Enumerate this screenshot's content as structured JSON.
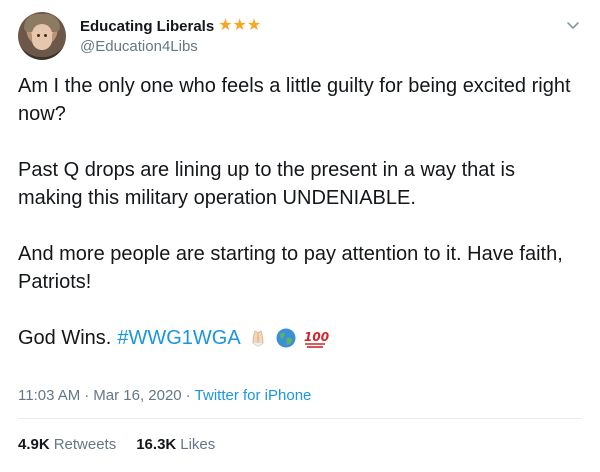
{
  "header": {
    "display_name": "Educating Liberals",
    "handle": "@Education4Libs",
    "badge_icons": [
      "star-icon",
      "star-icon",
      "star-icon"
    ],
    "more_icon": "chevron-down-icon"
  },
  "body": {
    "para1": "Am I the only one who feels a little guilty for being excited right now?",
    "para2": "Past Q drops are lining up to the present in a way that is making this military operation UNDENIABLE.",
    "para3": "And more people are starting to pay attention to it. Have faith, Patriots!",
    "para4_text": "God Wins.",
    "para4_hashtag": "#WWG1WGA",
    "emojis": [
      "praying-hands-icon",
      "globe-icon",
      "hundred-points-icon"
    ]
  },
  "meta": {
    "time": "11:03 AM",
    "separator": "·",
    "date": "Mar 16, 2020",
    "source": "Twitter for iPhone"
  },
  "stats": {
    "retweets_count": "4.9K",
    "retweets_label": "Retweets",
    "likes_count": "16.3K",
    "likes_label": "Likes"
  },
  "colors": {
    "link": "#1b95e0",
    "secondary": "#657786",
    "star": "#f5a623"
  }
}
